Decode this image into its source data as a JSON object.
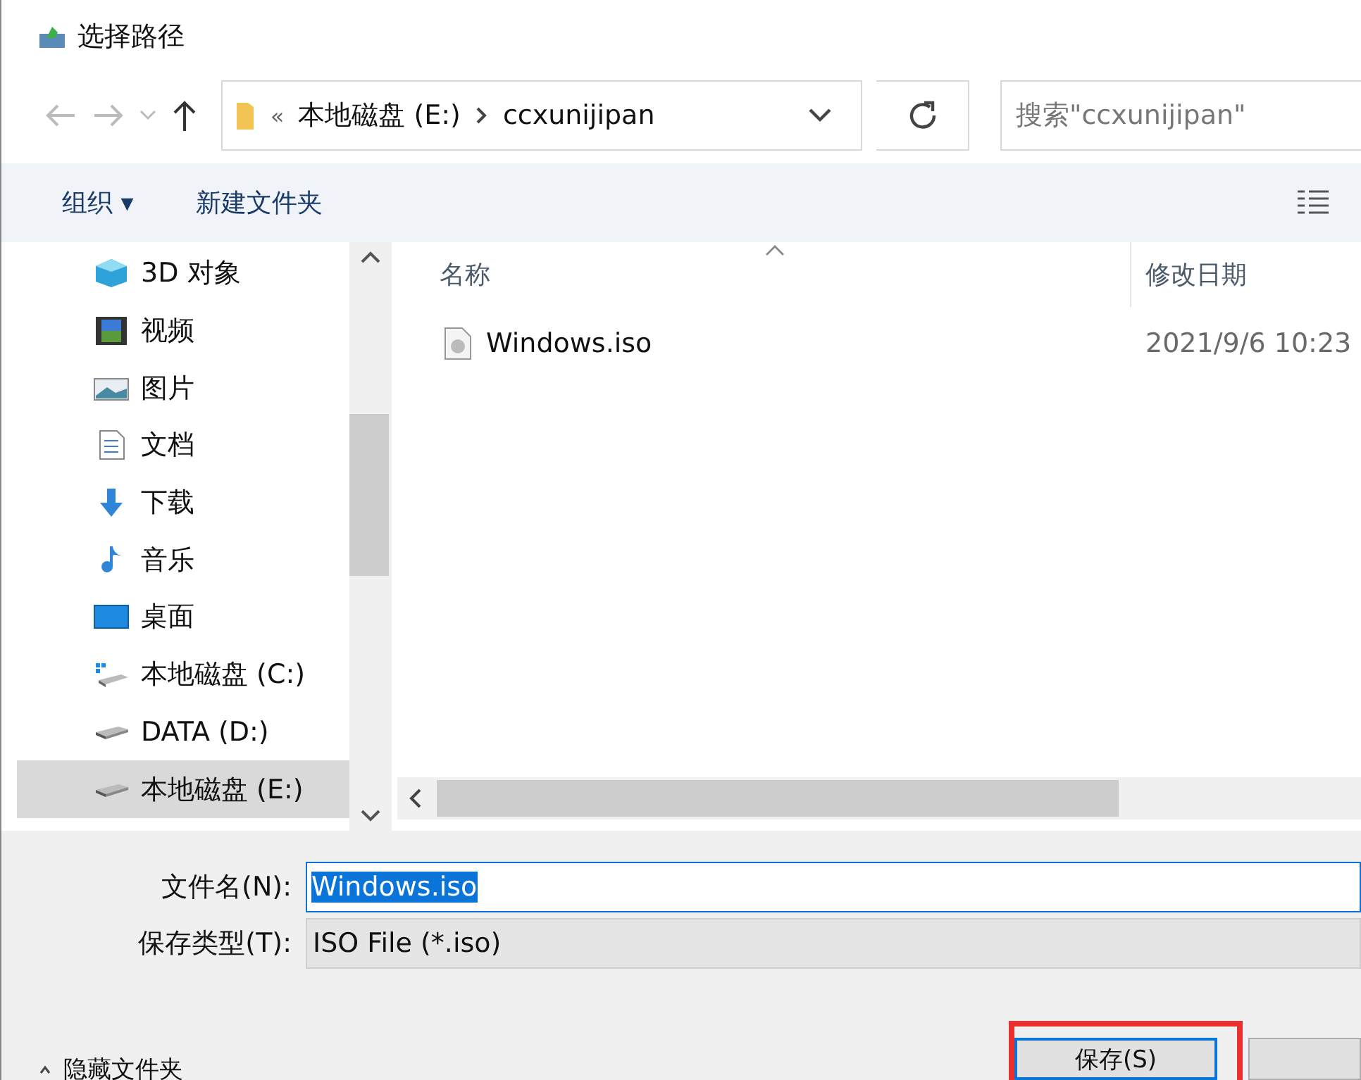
{
  "window": {
    "title": "选择路径"
  },
  "address_bar": {
    "overflow": "«",
    "segments": [
      "本地磁盘 (E:)",
      "ccxunijipan"
    ]
  },
  "search": {
    "placeholder": "搜索\"ccxunijipan\""
  },
  "toolbar": {
    "organize": "组织 ▾",
    "new_folder": "新建文件夹"
  },
  "sidebar": {
    "items": [
      {
        "label": "3D 对象",
        "kind": "objects3d",
        "selected": false
      },
      {
        "label": "视频",
        "kind": "video",
        "selected": false
      },
      {
        "label": "图片",
        "kind": "pictures",
        "selected": false
      },
      {
        "label": "文档",
        "kind": "documents",
        "selected": false
      },
      {
        "label": "下载",
        "kind": "downloads",
        "selected": false
      },
      {
        "label": "音乐",
        "kind": "music",
        "selected": false
      },
      {
        "label": "桌面",
        "kind": "desktop",
        "selected": false
      },
      {
        "label": "本地磁盘 (C:)",
        "kind": "systemdrive",
        "selected": false
      },
      {
        "label": "DATA (D:)",
        "kind": "drive",
        "selected": false
      },
      {
        "label": "本地磁盘 (E:)",
        "kind": "drive",
        "selected": true
      }
    ]
  },
  "file_list": {
    "columns": [
      "名称",
      "修改日期"
    ],
    "rows": [
      {
        "name": "Windows.iso",
        "modified": "2021/9/6 10:23"
      }
    ]
  },
  "form": {
    "file_name_label": "文件名(N):",
    "file_name": "Windows.iso",
    "type_label": "保存类型(T):",
    "type": "ISO File (*.iso)"
  },
  "footer": {
    "hide_folders": "隐藏文件夹",
    "save": "保存(S)",
    "save_highlighted": true
  }
}
